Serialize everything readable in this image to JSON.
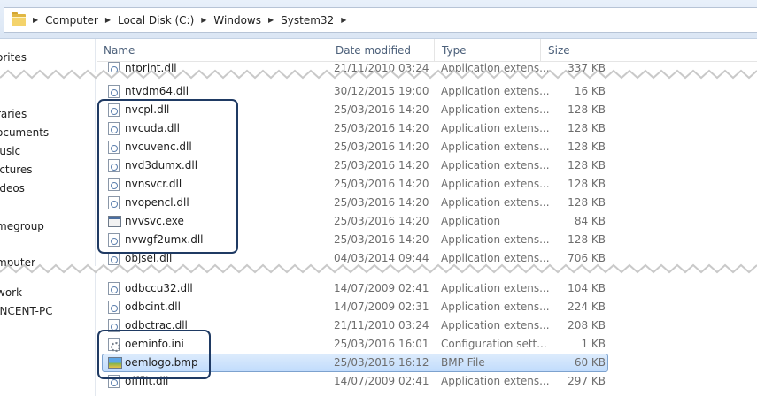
{
  "breadcrumb": {
    "items": [
      "Computer",
      "Local Disk (C:)",
      "Windows",
      "System32"
    ]
  },
  "navpane": {
    "items": [
      "orites",
      "raries",
      "ocuments",
      "lusic",
      "ictures",
      "ideos",
      "megroup",
      "mputer",
      "work",
      "INCENT-PC"
    ]
  },
  "columns": {
    "name": "Name",
    "date": "Date modified",
    "type": "Type",
    "size": "Size"
  },
  "files": [
    {
      "name": "ntprint.dll",
      "date": "21/11/2010 03:24",
      "type": "Application extens...",
      "size": "337 KB",
      "icon": "dll-icon"
    },
    {
      "name": "ntvdm64.dll",
      "date": "30/12/2015 19:00",
      "type": "Application extens...",
      "size": "16 KB",
      "icon": "dll-icon"
    },
    {
      "name": "nvcpl.dll",
      "date": "25/03/2016 14:20",
      "type": "Application extens...",
      "size": "128 KB",
      "icon": "dll-icon"
    },
    {
      "name": "nvcuda.dll",
      "date": "25/03/2016 14:20",
      "type": "Application extens...",
      "size": "128 KB",
      "icon": "dll-icon"
    },
    {
      "name": "nvcuvenc.dll",
      "date": "25/03/2016 14:20",
      "type": "Application extens...",
      "size": "128 KB",
      "icon": "dll-icon"
    },
    {
      "name": "nvd3dumx.dll",
      "date": "25/03/2016 14:20",
      "type": "Application extens...",
      "size": "128 KB",
      "icon": "dll-icon"
    },
    {
      "name": "nvnsvcr.dll",
      "date": "25/03/2016 14:20",
      "type": "Application extens...",
      "size": "128 KB",
      "icon": "dll-icon"
    },
    {
      "name": "nvopencl.dll",
      "date": "25/03/2016 14:20",
      "type": "Application extens...",
      "size": "128 KB",
      "icon": "dll-icon"
    },
    {
      "name": "nvvsvc.exe",
      "date": "25/03/2016 14:20",
      "type": "Application",
      "size": "84 KB",
      "icon": "exe-icon"
    },
    {
      "name": "nvwgf2umx.dll",
      "date": "25/03/2016 14:20",
      "type": "Application extens...",
      "size": "128 KB",
      "icon": "dll-icon"
    },
    {
      "name": "objsel.dll",
      "date": "04/03/2014 09:44",
      "type": "Application extens...",
      "size": "706 KB",
      "icon": "dll-icon"
    },
    {
      "name": "odbccu32.dll",
      "date": "14/07/2009 02:41",
      "type": "Application extens...",
      "size": "104 KB",
      "icon": "dll-icon"
    },
    {
      "name": "odbcint.dll",
      "date": "14/07/2009 02:31",
      "type": "Application extens...",
      "size": "224 KB",
      "icon": "dll-icon"
    },
    {
      "name": "odbctrac.dll",
      "date": "21/11/2010 03:24",
      "type": "Application extens...",
      "size": "208 KB",
      "icon": "dll-icon"
    },
    {
      "name": "oeminfo.ini",
      "date": "25/03/2016 16:01",
      "type": "Configuration sett...",
      "size": "1 KB",
      "icon": "settings-file-icon"
    },
    {
      "name": "oemlogo.bmp",
      "date": "25/03/2016 16:12",
      "type": "BMP File",
      "size": "60 KB",
      "icon": "bitmap-icon"
    },
    {
      "name": "offfilt.dll",
      "date": "14/07/2009 02:41",
      "type": "Application extens...",
      "size": "297 KB",
      "icon": "dll-icon"
    }
  ],
  "selected_file": "oemlogo.bmp"
}
